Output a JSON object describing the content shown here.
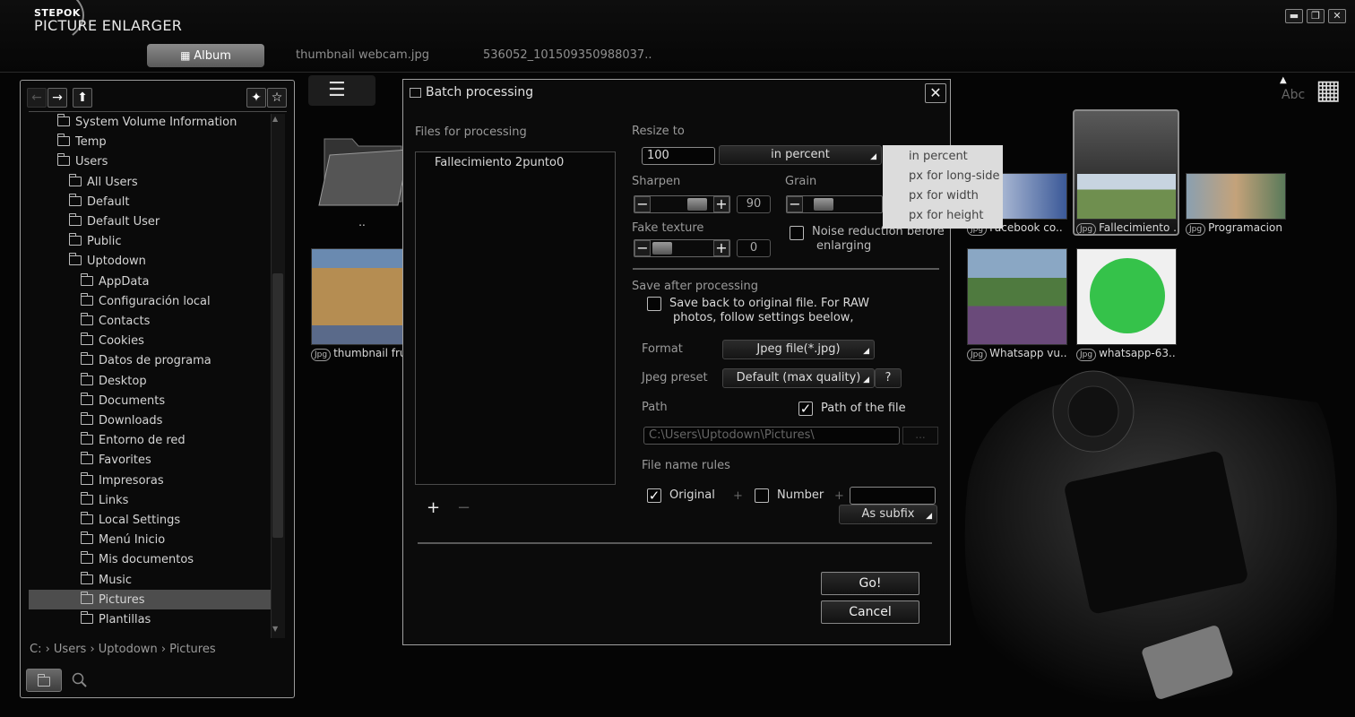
{
  "app": {
    "logo_top": "STEPOK",
    "logo_main": "PICTURE ENLARGER",
    "tabs": [
      {
        "label": "Album"
      },
      {
        "label": "thumbnail webcam.jpg"
      },
      {
        "label": "536052_101509350988037.."
      }
    ]
  },
  "tree": {
    "items": [
      "System Volume Information",
      "Temp",
      "Users",
      "All Users",
      "Default",
      "Default User",
      "Public",
      "Uptodown",
      "AppData",
      "Configuración local",
      "Contacts",
      "Cookies",
      "Datos de programa",
      "Desktop",
      "Documents",
      "Downloads",
      "Entorno de red",
      "Favorites",
      "Impresoras",
      "Links",
      "Local Settings",
      "Menú Inicio",
      "Mis documentos",
      "Music",
      "Pictures",
      "Plantillas"
    ],
    "breadcrumb": "C: › Users › Uptodown › Pictures"
  },
  "gallery": {
    "thumbs": [
      {
        "caption": "..",
        "tag": ""
      },
      {
        "caption": "thumbnail fru..",
        "tag": "Jpg"
      },
      {
        "caption": "Facebook co..",
        "tag": "Jpg"
      },
      {
        "caption": "Fallecimiento ..",
        "tag": "Jpg"
      },
      {
        "caption": "Programacion ..",
        "tag": "Jpg"
      },
      {
        "caption": "Whatsapp vu..",
        "tag": "Jpg"
      },
      {
        "caption": "whatsapp-63..",
        "tag": "Jpg"
      }
    ],
    "sort_label": "Abc"
  },
  "dialog": {
    "title": "Batch processing",
    "files_label": "Files for processing",
    "files": [
      "Fallecimiento 2punto0"
    ],
    "add_label": "+",
    "remove_label": "−",
    "resize_label": "Resize to",
    "resize_value": "100",
    "resize_unit": "in percent",
    "unit_options": [
      "in percent",
      "px for long-side",
      "px for width",
      "px for height"
    ],
    "sharpen_label": "Sharpen",
    "sharpen_value": "90",
    "grain_label": "Grain",
    "texture_label": "Fake texture",
    "texture_value": "0",
    "noise_label_1": "Noise reduction before",
    "noise_label_2": "enlarging",
    "save_after_label": "Save after processing",
    "save_back_1": "Save back to original file. For RAW",
    "save_back_2": "photos, follow settings beelow,",
    "format_label": "Format",
    "format_value": "Jpeg file(*.jpg)",
    "preset_label": "Jpeg preset",
    "preset_value": "Default (max quality)",
    "preset_help": "?",
    "path_label": "Path",
    "path_of_file_label": "Path of the file",
    "path_value": "C:\\Users\\Uptodown\\Pictures\\",
    "browse_label": "...",
    "filename_rules_label": "File name rules",
    "original_label": "Original",
    "plus": "+",
    "number_label": "Number",
    "subfix_value": "As subfix",
    "go_label": "Go!",
    "cancel_label": "Cancel"
  }
}
